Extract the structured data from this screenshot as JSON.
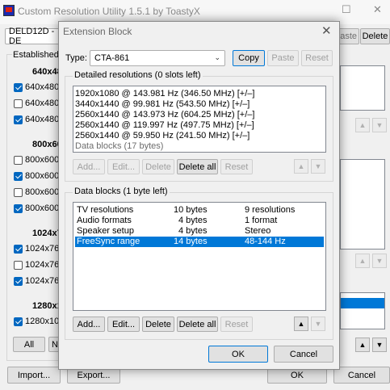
{
  "main": {
    "title": "Custom Resolution Utility 1.5.1 by ToastyX",
    "monitor_select": "DELD12D - DE",
    "paste_label": "aste",
    "delete_label": "Delete",
    "established_label": "Established",
    "established": [
      {
        "label": "640x480",
        "checked": true
      },
      {
        "label": "640x480",
        "checked": false
      },
      {
        "label": "640x480",
        "checked": true
      }
    ],
    "sections": [
      {
        "header": "800x60",
        "items": [
          {
            "label": "800x600",
            "checked": false
          },
          {
            "label": "800x600",
            "checked": true
          },
          {
            "label": "800x600",
            "checked": false
          },
          {
            "label": "800x600",
            "checked": true
          }
        ]
      },
      {
        "header": "1024x7",
        "items": [
          {
            "label": "1024x76",
            "checked": true
          },
          {
            "label": "1024x76",
            "checked": false
          },
          {
            "label": "1024x76",
            "checked": true
          }
        ]
      },
      {
        "header": "1280x1",
        "items": [
          {
            "label": "1280x10",
            "checked": true
          }
        ]
      }
    ],
    "all_label": "All",
    "none_label": "No",
    "import_label": "Import...",
    "export_label": "Export...",
    "ok_label": "OK",
    "cancel_label": "Cancel"
  },
  "dialog": {
    "title": "Extension Block",
    "type_label": "Type:",
    "type_value": "CTA-861",
    "copy_label": "Copy",
    "paste_label": "Paste",
    "reset_label": "Reset",
    "detailed": {
      "title": "Detailed resolutions (0 slots left)",
      "items": [
        "1920x1080 @ 143.981 Hz (346.50 MHz) [+/–]",
        "3440x1440 @ 99.981 Hz (543.50 MHz) [+/–]",
        "2560x1440 @ 143.973 Hz (604.25 MHz) [+/–]",
        "2560x1440 @ 119.997 Hz (497.75 MHz) [+/–]",
        "2560x1440 @ 59.950 Hz (241.50 MHz) [+/–]"
      ],
      "footer": "Data blocks (17 bytes)",
      "buttons": {
        "add": "Add...",
        "edit": "Edit...",
        "delete": "Delete",
        "delete_all": "Delete all",
        "reset": "Reset"
      }
    },
    "datablocks": {
      "title": "Data blocks (1 byte left)",
      "rows": [
        {
          "name": "TV resolutions",
          "size": "10 bytes",
          "info": "9 resolutions",
          "selected": false
        },
        {
          "name": "Audio formats",
          "size": "4 bytes",
          "info": "1 format",
          "selected": false
        },
        {
          "name": "Speaker setup",
          "size": "4 bytes",
          "info": "Stereo",
          "selected": false
        },
        {
          "name": "FreeSync range",
          "size": "14 bytes",
          "info": "48-144 Hz",
          "selected": true
        }
      ],
      "buttons": {
        "add": "Add...",
        "edit": "Edit...",
        "delete": "Delete",
        "delete_all": "Delete all",
        "reset": "Reset"
      }
    },
    "ok_label": "OK",
    "cancel_label": "Cancel"
  },
  "icons": {
    "up": "arrow-up-icon",
    "down": "arrow-down-icon",
    "close": "close-icon"
  },
  "colors": {
    "selection": "#0078d7",
    "accent_border": "#0078d7"
  }
}
